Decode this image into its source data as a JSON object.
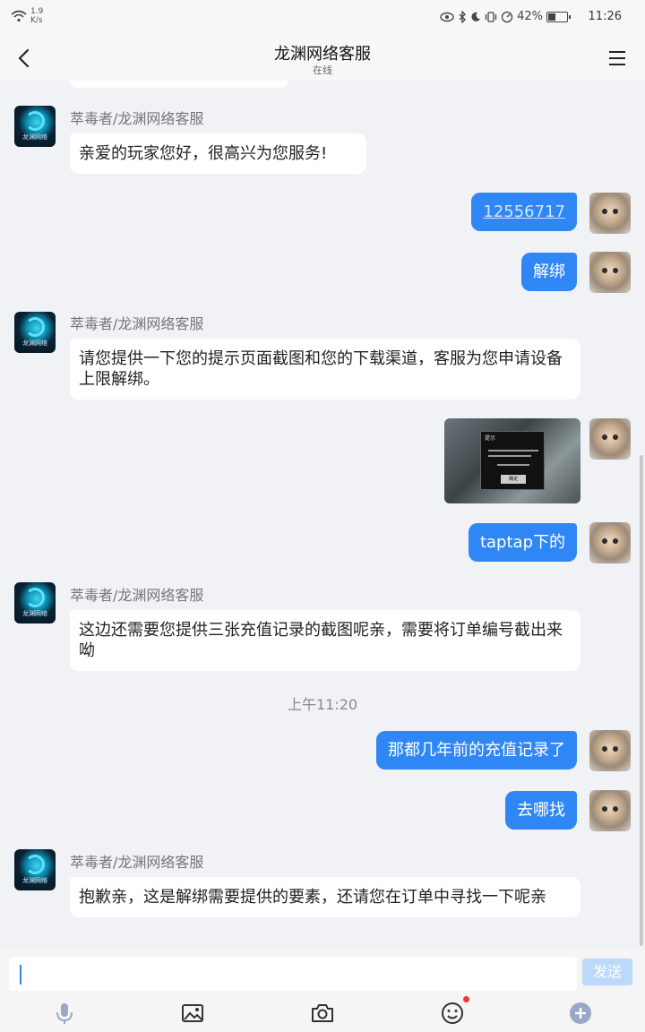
{
  "status_bar": {
    "net_speed_value": "1.9",
    "net_speed_unit": "K/s",
    "battery_percent": "42%",
    "battery_level": 0.42,
    "time": "11:26"
  },
  "header": {
    "title": "龙渊网络客服",
    "subtitle": "在线"
  },
  "messages": [
    {
      "from": "agent",
      "sender": "萃毒者/龙渊网络客服",
      "text": "亲爱的玩家您好，很高兴为您服务!"
    },
    {
      "from": "user",
      "text": "12556717",
      "is_link": true
    },
    {
      "from": "user",
      "text": "解绑"
    },
    {
      "from": "agent",
      "sender": "萃毒者/龙渊网络客服",
      "text": "请您提供一下您的提示页面截图和您的下载渠道，客服为您申请设备上限解绑。"
    },
    {
      "from": "user",
      "type": "image",
      "image_title": "提示",
      "image_button": "确定"
    },
    {
      "from": "user",
      "text": "taptap下的"
    },
    {
      "from": "agent",
      "sender": "萃毒者/龙渊网络客服",
      "text": "这边还需要您提供三张充值记录的截图呢亲，需要将订单编号截出来呦"
    },
    {
      "from": "system",
      "text": "上午11:20"
    },
    {
      "from": "user",
      "text": "那都几年前的充值记录了"
    },
    {
      "from": "user",
      "text": "去哪找"
    },
    {
      "from": "agent",
      "sender": "萃毒者/龙渊网络客服",
      "text": "抱歉亲，这是解绑需要提供的要素，还请您在订单中寻找一下呢亲"
    }
  ],
  "agent_avatar_text": "龙渊网络",
  "composer": {
    "send_label": "发送",
    "tools": [
      "microphone-icon",
      "image-icon",
      "camera-icon",
      "emoji-icon",
      "plus-icon"
    ]
  },
  "colors": {
    "accent": "#2f87f5",
    "send_disabled": "#bcd9fb",
    "badge": "#ff3333"
  }
}
